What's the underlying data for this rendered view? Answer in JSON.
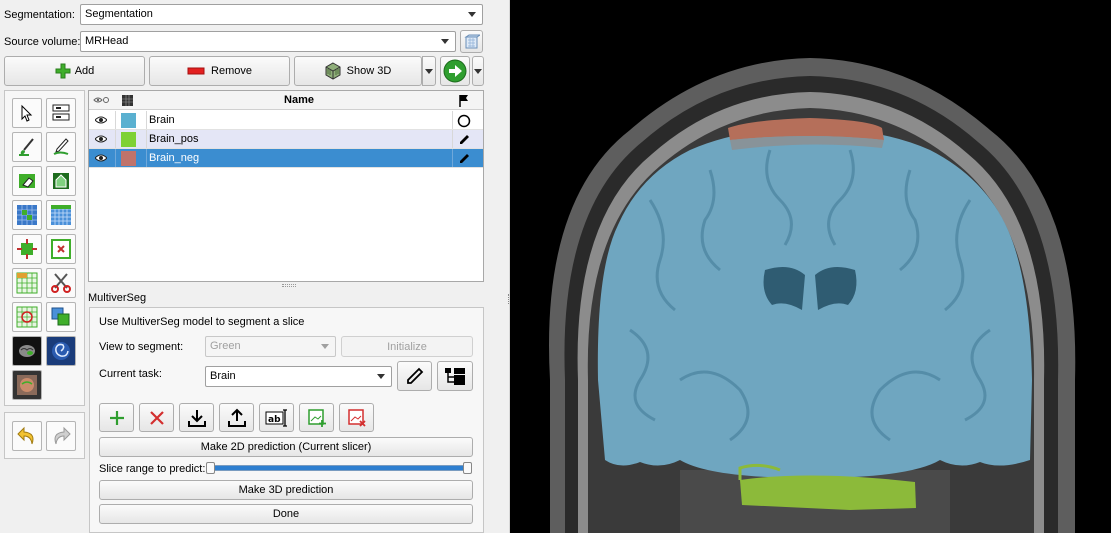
{
  "segmentation": {
    "label": "Segmentation:",
    "value": "Segmentation"
  },
  "source_volume": {
    "label": "Source volume:",
    "value": "MRHead"
  },
  "toolbar": {
    "add": "Add",
    "remove": "Remove",
    "show3d": "Show 3D"
  },
  "table": {
    "header": "Name",
    "rows": [
      {
        "name": "Brain",
        "color": "#5ab0d0",
        "status": "circle-icon"
      },
      {
        "name": "Brain_pos",
        "color": "#7ed134",
        "status": "pencil-icon"
      },
      {
        "name": "Brain_neg",
        "color": "#c0736b",
        "status": "pencil-icon"
      }
    ]
  },
  "module": {
    "section_title": "MultiverSeg",
    "description": "Use MultiverSeg model to segment a slice",
    "view_label": "View to segment:",
    "view_value": "Green",
    "initialize": "Initialize",
    "task_label": "Current task:",
    "task_value": "Brain",
    "predict2d": "Make 2D prediction (Current slicer)",
    "slice_range_label": "Slice range to predict:",
    "predict3d": "Make 3D prediction",
    "done": "Done"
  },
  "colors": {
    "selection": "#3b8dd0",
    "accent_green": "#2f9e2f",
    "accent_red": "#d32f2f"
  }
}
